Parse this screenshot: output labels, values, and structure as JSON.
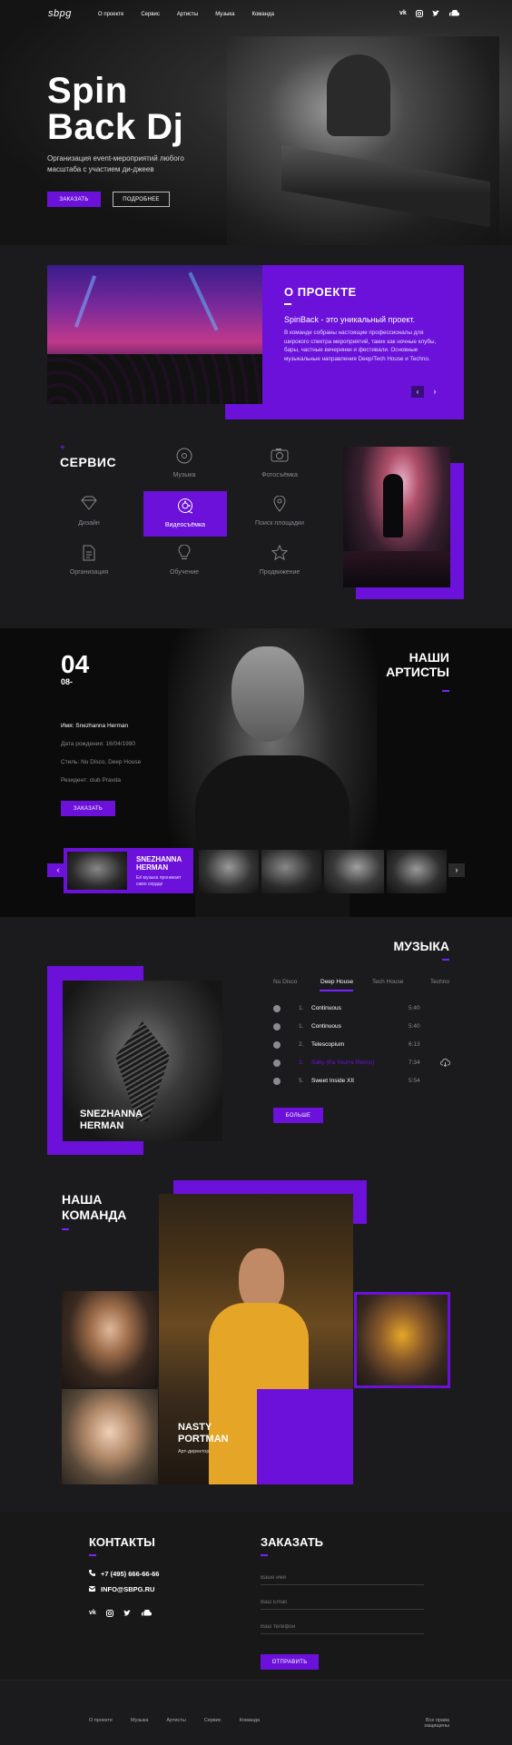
{
  "nav": {
    "logo": "sbpg",
    "items": [
      "О проекте",
      "Сервис",
      "Артисты",
      "Музыка",
      "Команда"
    ],
    "social": [
      "vk-icon",
      "instagram-icon",
      "twitter-icon",
      "soundcloud-icon"
    ]
  },
  "hero": {
    "title_line1": "Spin",
    "title_line2": "Back Dj",
    "subtitle": "Организация event-мероприятий любого масштаба с участием ди-джеев",
    "order_btn": "ЗАКАЗАТЬ",
    "more_btn": "ПОДРОБНЕЕ"
  },
  "about": {
    "heading": "О ПРОЕКТЕ",
    "lead": "SpinBack - это уникальный проект.",
    "body": "В команде собраны настоящие профессионалы для широкого спектра мероприятий, таких как ночные клубы, бары, частные вечеринки и фестивали. Основные музыкальные направления Deep/Tech House и Techno."
  },
  "service": {
    "heading": "СЕРВИС",
    "items": [
      {
        "label": "Музыка",
        "icon": "disc-icon"
      },
      {
        "label": "Фотосъёмка",
        "icon": "camera-icon"
      },
      {
        "label": "Дизайн",
        "icon": "diamond-icon"
      },
      {
        "label": "Видеосъёмка",
        "icon": "film-reel-icon"
      },
      {
        "label": "Поиск площадки",
        "icon": "location-icon"
      },
      {
        "label": "Организация",
        "icon": "document-icon"
      },
      {
        "label": "Обучение",
        "icon": "bulb-icon"
      },
      {
        "label": "Продвижение",
        "icon": "star-icon"
      }
    ]
  },
  "artists": {
    "heading_line1": "НАШИ",
    "heading_line2": "АРТИСТЫ",
    "num": "04",
    "num_sub": "08-",
    "name": "Имя: Snezhanna Herman",
    "dob": "Дата рождения: 16/04/1990",
    "style": "Стиль: Nu Disco, Deep House",
    "resident": "Резидент: club Pravda",
    "order_btn": "ЗАКАЗАТЬ",
    "card_name_line1": "SNEZHANNA",
    "card_name_line2": "HERMAN",
    "card_quote": "Её музыка проникает само сердце"
  },
  "music": {
    "heading": "МУЗЫКА",
    "cover_line1": "SNEZHANNA",
    "cover_line2": "HERMAN",
    "tabs": [
      "Nu Disco",
      "Deep House",
      "Tech House",
      "Techno"
    ],
    "tracks": [
      {
        "n": "1.",
        "title": "Continuous",
        "time": "5:40"
      },
      {
        "n": "1.",
        "title": "Continuous",
        "time": "5:40"
      },
      {
        "n": "2.",
        "title": "Telescopium",
        "time": "6:13"
      },
      {
        "n": "3.",
        "title": "Salty (Pa Yourre Remix)",
        "time": "7:34"
      },
      {
        "n": "5.",
        "title": "Sweet Inside XII",
        "time": "5:54"
      }
    ],
    "more_btn": "БОЛЬШЕ"
  },
  "team": {
    "heading_line1": "НАША",
    "heading_line2": "КОМАНДА",
    "name_line1": "NASTY",
    "name_line2": "PORTMAN",
    "role": "Арт-директор"
  },
  "contacts": {
    "heading": "КОНТАКТЫ",
    "phone": "+7 (495) 666-66-66",
    "email": "INFO@SBPG.RU"
  },
  "order": {
    "heading": "ЗАКАЗАТЬ",
    "name_ph": "Ваше имя",
    "email_ph": "Ваш Email",
    "phone_ph": "Ваш телефон",
    "submit": "ОТПРАВИТЬ"
  },
  "footer": {
    "links": [
      "О проекте",
      "Музыка",
      "Артисты",
      "Сервис",
      "Команда"
    ],
    "rights": "Все права защищены"
  },
  "colors": {
    "accent": "#6b11d9",
    "bg": "#1b1b1d"
  }
}
